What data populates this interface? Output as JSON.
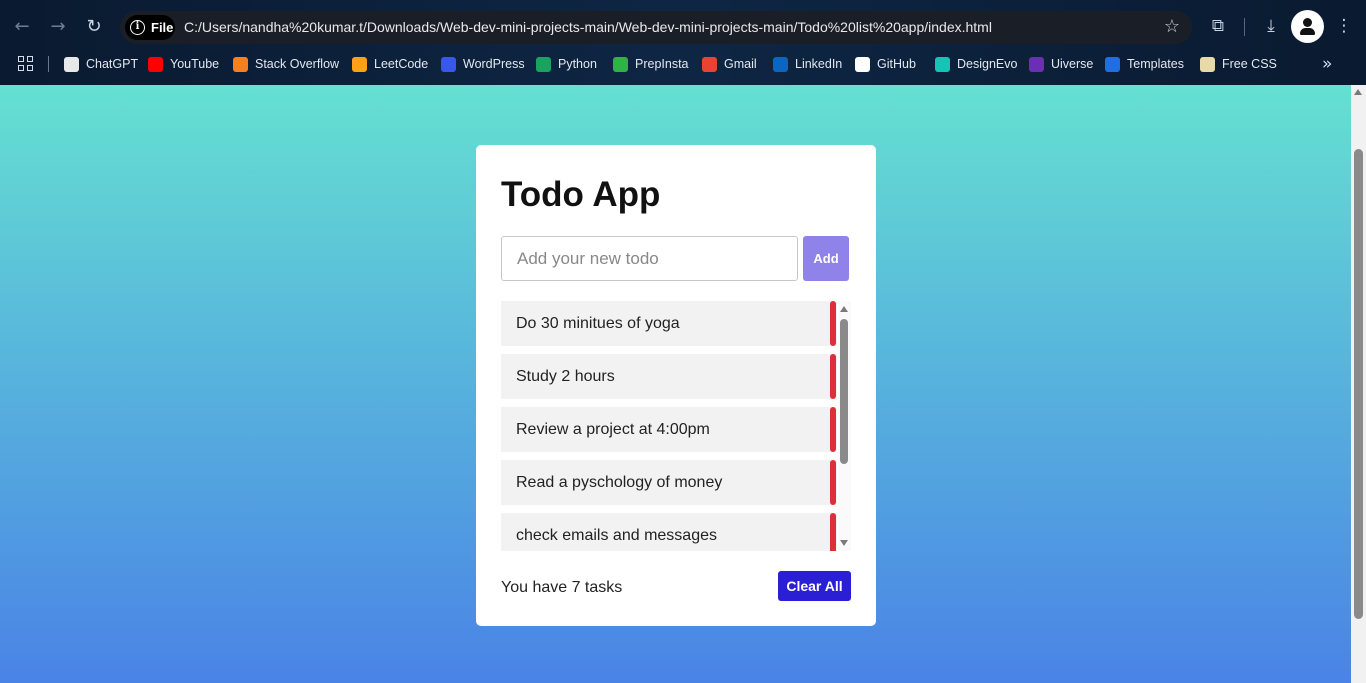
{
  "browser": {
    "site_chip": "File",
    "url": "C:/Users/nandha%20kumar.t/Downloads/Web-dev-mini-projects-main/Web-dev-mini-projects-main/Todo%20list%20app/index.html",
    "bookmarks": [
      {
        "label": "ChatGPT",
        "icon": "chatgpt-icon",
        "color": "#e8e8e8"
      },
      {
        "label": "YouTube",
        "icon": "youtube-icon",
        "color": "#ff0000"
      },
      {
        "label": "Stack Overflow",
        "icon": "stackoverflow-icon",
        "color": "#f48024"
      },
      {
        "label": "LeetCode",
        "icon": "leetcode-icon",
        "color": "#ffa116"
      },
      {
        "label": "WordPress",
        "icon": "wordpress-icon",
        "color": "#3858e9"
      },
      {
        "label": "Python",
        "icon": "python-icon",
        "color": "#1aa260"
      },
      {
        "label": "PrepInsta",
        "icon": "prepinsta-icon",
        "color": "#2fb344"
      },
      {
        "label": "Gmail",
        "icon": "gmail-icon",
        "color": "#ea4335"
      },
      {
        "label": "LinkedIn",
        "icon": "linkedin-icon",
        "color": "#0a66c2"
      },
      {
        "label": "GitHub",
        "icon": "github-icon",
        "color": "#ffffff"
      },
      {
        "label": "DesignEvo",
        "icon": "designevo-icon",
        "color": "#14c4b4"
      },
      {
        "label": "Uiverse",
        "icon": "uiverse-icon",
        "color": "#6b2fb3"
      },
      {
        "label": "Templates",
        "icon": "templatemo-icon",
        "color": "#1f6fe0"
      },
      {
        "label": "Free CSS",
        "icon": "freecss-icon",
        "color": "#e8d9a8"
      }
    ]
  },
  "app": {
    "title": "Todo App",
    "input_placeholder": "Add your new todo",
    "add_label": "Add",
    "todos": [
      "Do 30 minitues of yoga",
      "Study 2 hours",
      "Review a project at 4:00pm",
      "Read a pyschology of money",
      "check emails and messages"
    ],
    "count_text": "You have 7 tasks",
    "clear_label": "Clear All"
  },
  "colors": {
    "accent_add": "#8f82e9",
    "accent_clear": "#2a1fd4",
    "delete_bar": "#dc2f3a"
  }
}
